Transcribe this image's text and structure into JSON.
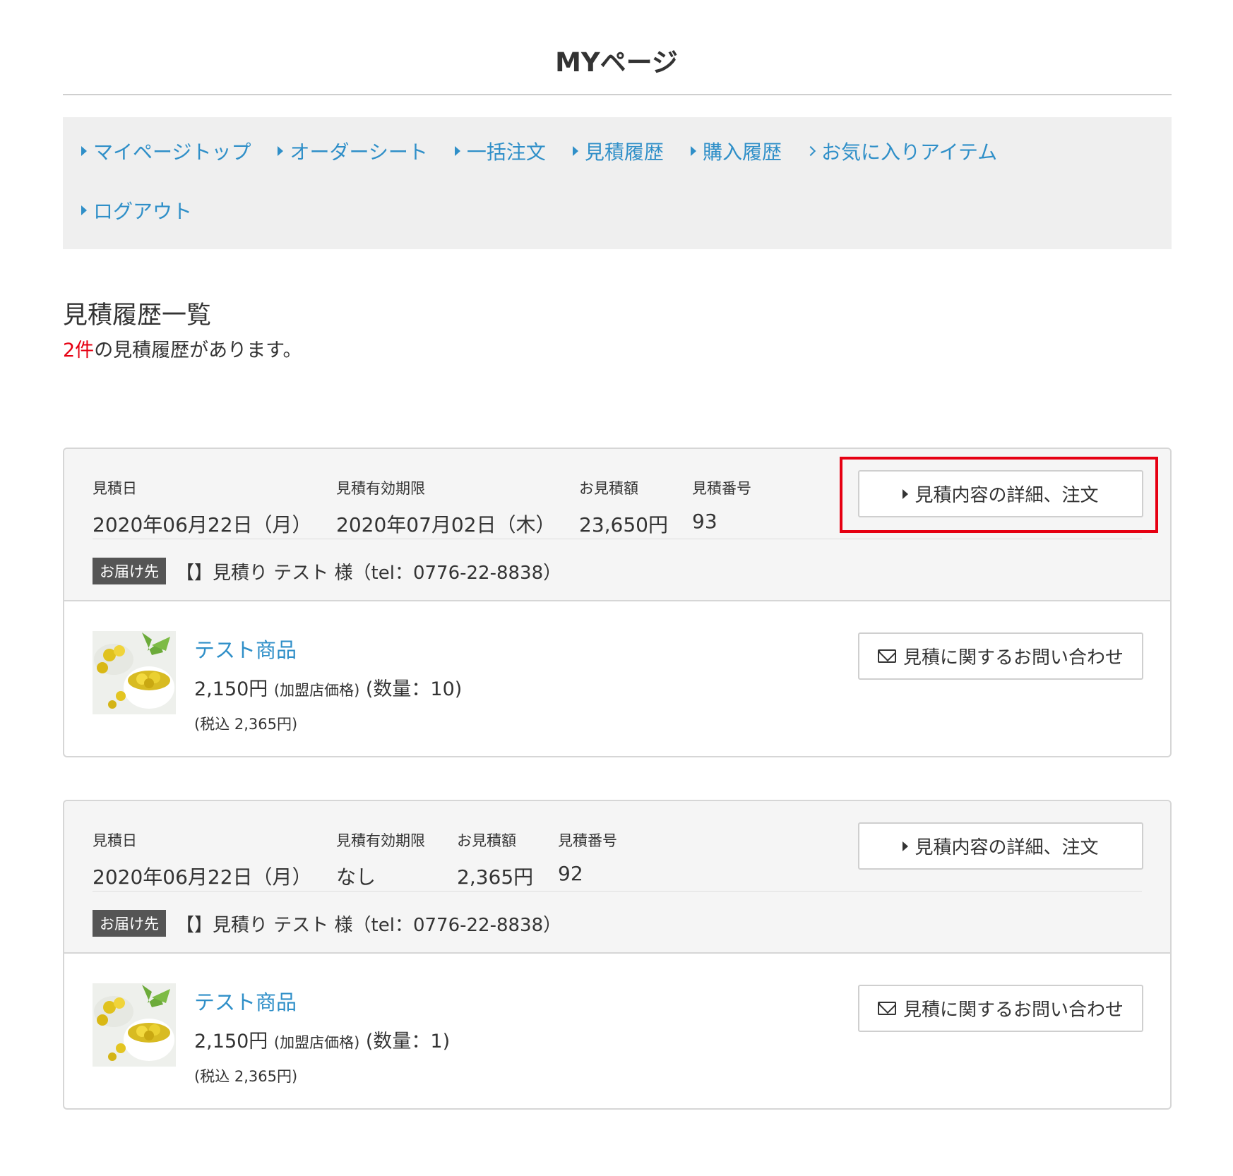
{
  "page": {
    "title": "MYページ"
  },
  "nav": {
    "items": [
      {
        "label": "マイページトップ",
        "icon": "caret-right-icon"
      },
      {
        "label": "オーダーシート",
        "icon": "caret-right-icon"
      },
      {
        "label": "一括注文",
        "icon": "caret-right-icon"
      },
      {
        "label": "見積履歴",
        "icon": "caret-right-icon"
      },
      {
        "label": "購入履歴",
        "icon": "caret-right-icon"
      },
      {
        "label": "お気に入りアイテム",
        "icon": "chevron-right-icon"
      },
      {
        "label": "ログアウト",
        "icon": "caret-right-icon"
      }
    ]
  },
  "section": {
    "title": "見積履歴一覧",
    "count": "2件",
    "count_suffix": "の見積履歴があります。",
    "count_color": "#e60012"
  },
  "labels": {
    "date": "見積日",
    "expiry": "見積有効期限",
    "amount": "お見積額",
    "number": "見積番号",
    "ship_badge": "お届け先",
    "detail_button": "見積内容の詳細、注文",
    "inquiry_button": "見積に関するお問い合わせ"
  },
  "quotes": [
    {
      "date": "2020年06月22日（月）",
      "expiry": "2020年07月02日（木）",
      "amount": "23,650円",
      "number": "93",
      "ship_to": "【】見積り テスト 様（tel：0776-22-8838）",
      "item": {
        "name": "テスト商品",
        "price": "2,150円",
        "price_note": "(加盟店価格)",
        "quantity": "(数量：10)",
        "tax": "(税込 2,365円)"
      }
    },
    {
      "date": "2020年06月22日（月）",
      "expiry": "なし",
      "amount": "2,365円",
      "number": "92",
      "ship_to": "【】見積り テスト 様（tel：0776-22-8838）",
      "item": {
        "name": "テスト商品",
        "price": "2,150円",
        "price_note": "(加盟店価格)",
        "quantity": "(数量：1)",
        "tax": "(税込 2,365円)"
      }
    }
  ],
  "colors": {
    "link": "#2f8fc8",
    "highlight": "#e60012",
    "nav_bg": "#efefef"
  }
}
